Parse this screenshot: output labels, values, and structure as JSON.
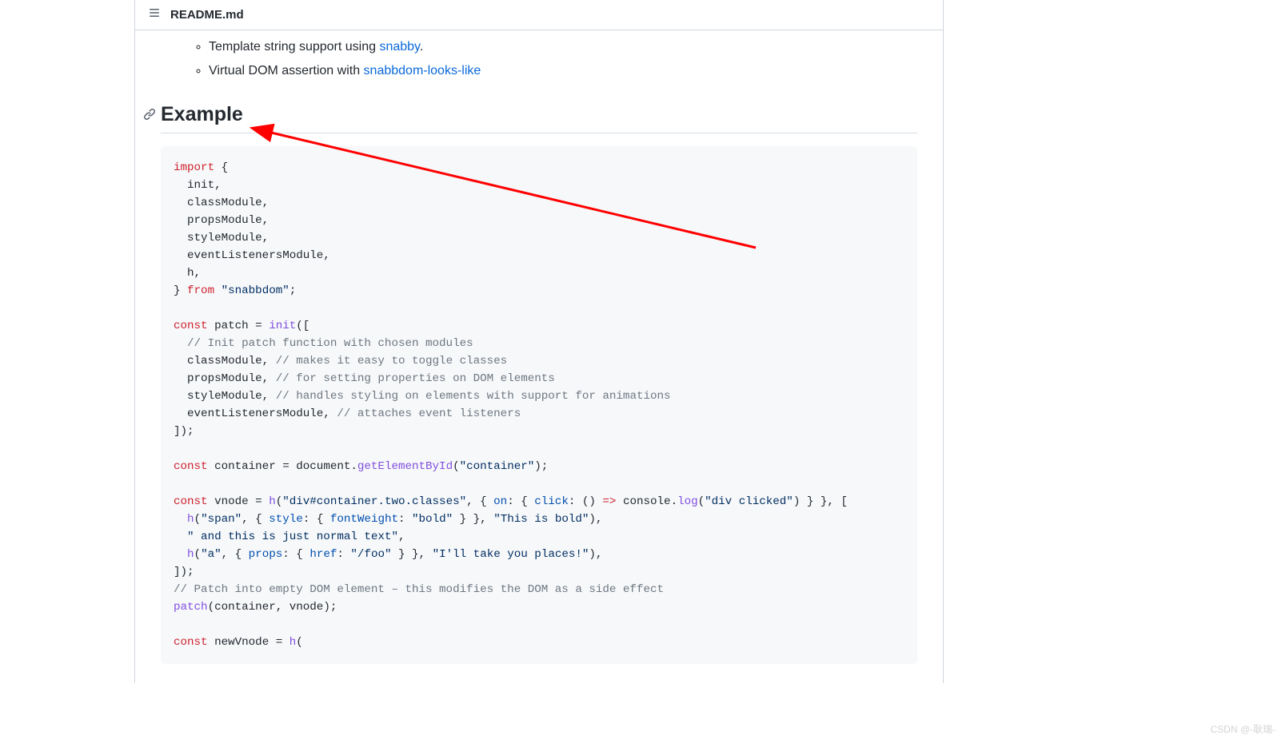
{
  "header": {
    "title": "README.md"
  },
  "list": {
    "item1_prefix": "Template string support using ",
    "item1_link": "snabby",
    "item1_suffix": ".",
    "item2_prefix": "Virtual DOM assertion with ",
    "item2_link": "snabbdom-looks-like"
  },
  "section": {
    "heading": "Example"
  },
  "code": {
    "l01a": "import",
    "l01b": " {",
    "l02": "  init,",
    "l03": "  classModule,",
    "l04": "  propsModule,",
    "l05": "  styleModule,",
    "l06": "  eventListenersModule,",
    "l07": "  h,",
    "l08a": "} ",
    "l08b": "from",
    "l08c": " ",
    "l08d": "\"snabbdom\"",
    "l08e": ";",
    "l10a": "const",
    "l10b": " patch = ",
    "l10c": "init",
    "l10d": "([",
    "l11a": "  ",
    "l11b": "// Init patch function with chosen modules",
    "l12a": "  classModule, ",
    "l12b": "// makes it easy to toggle classes",
    "l13a": "  propsModule, ",
    "l13b": "// for setting properties on DOM elements",
    "l14a": "  styleModule, ",
    "l14b": "// handles styling on elements with support for animations",
    "l15a": "  eventListenersModule, ",
    "l15b": "// attaches event listeners",
    "l16": "]);",
    "l18a": "const",
    "l18b": " container = document.",
    "l18c": "getElementById",
    "l18d": "(",
    "l18e": "\"container\"",
    "l18f": ");",
    "l20a": "const",
    "l20b": " vnode = ",
    "l20c": "h",
    "l20d": "(",
    "l20e": "\"div#container.two.classes\"",
    "l20f": ", { ",
    "l20g": "on",
    "l20h": ": { ",
    "l20i": "click",
    "l20j": ": () ",
    "l20k": "=>",
    "l20l": " console.",
    "l20m": "log",
    "l20n": "(",
    "l20o": "\"div clicked\"",
    "l20p": ") } }, [",
    "l21a": "  ",
    "l21b": "h",
    "l21c": "(",
    "l21d": "\"span\"",
    "l21e": ", { ",
    "l21f": "style",
    "l21g": ": { ",
    "l21h": "fontWeight",
    "l21i": ": ",
    "l21j": "\"bold\"",
    "l21k": " } }, ",
    "l21l": "\"This is bold\"",
    "l21m": "),",
    "l22a": "  ",
    "l22b": "\" and this is just normal text\"",
    "l22c": ",",
    "l23a": "  ",
    "l23b": "h",
    "l23c": "(",
    "l23d": "\"a\"",
    "l23e": ", { ",
    "l23f": "props",
    "l23g": ": { ",
    "l23h": "href",
    "l23i": ": ",
    "l23j": "\"/foo\"",
    "l23k": " } }, ",
    "l23l": "\"I'll take you places!\"",
    "l23m": "),",
    "l24": "]);",
    "l25": "// Patch into empty DOM element – this modifies the DOM as a side effect",
    "l26a": "patch",
    "l26b": "(container, vnode);",
    "l28a": "const",
    "l28b": " newVnode = ",
    "l28c": "h",
    "l28d": "("
  },
  "watermark": "CSDN @-耿瑞-"
}
